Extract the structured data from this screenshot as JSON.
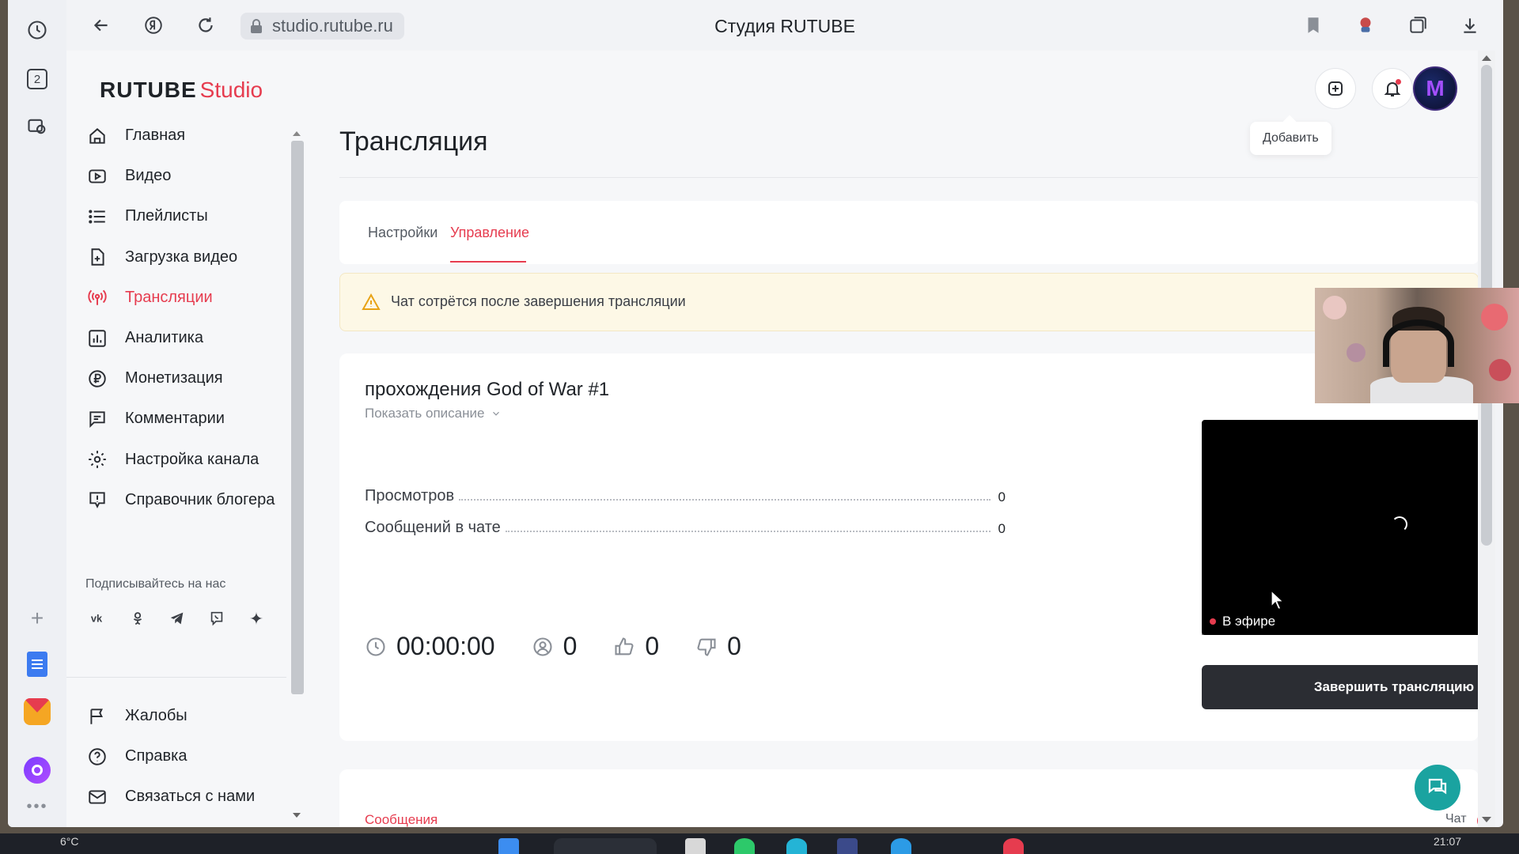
{
  "browser": {
    "url": "studio.rutube.ru",
    "tab_title": "Студия RUTUBE",
    "left_panel": {
      "tabs_count": "2"
    }
  },
  "app": {
    "logo_main": "RUTUBE",
    "logo_studio": "Studio",
    "tooltip_add": "Добавить"
  },
  "sidebar": {
    "items": [
      {
        "label": "Главная",
        "icon": "home-icon"
      },
      {
        "label": "Видео",
        "icon": "video-icon"
      },
      {
        "label": "Плейлисты",
        "icon": "list-icon"
      },
      {
        "label": "Загрузка видео",
        "icon": "upload-icon"
      },
      {
        "label": "Трансляции",
        "icon": "broadcast-icon",
        "active": true
      },
      {
        "label": "Аналитика",
        "icon": "chart-icon"
      },
      {
        "label": "Монетизация",
        "icon": "ruble-icon"
      },
      {
        "label": "Комментарии",
        "icon": "comment-icon"
      },
      {
        "label": "Настройка канала",
        "icon": "gear-icon"
      },
      {
        "label": "Справочник блогера",
        "icon": "info-icon"
      }
    ],
    "follow_title": "Подписывайтесь на нас",
    "socials": [
      "vk-icon",
      "ok-icon",
      "telegram-icon",
      "viber-icon",
      "dzen-icon"
    ],
    "bottom_items": [
      {
        "label": "Жалобы",
        "icon": "flag-icon"
      },
      {
        "label": "Справка",
        "icon": "help-icon"
      },
      {
        "label": "Связаться с нами",
        "icon": "mail-icon"
      }
    ]
  },
  "main": {
    "heading": "Трансляция",
    "tabs": [
      {
        "label": "Настройки"
      },
      {
        "label": "Управление",
        "active": true
      }
    ],
    "alert": "Чат сотрётся после завершения трансляции",
    "stream": {
      "title": "прохождения God of War #1",
      "show_description": "Показать описание",
      "stats": [
        {
          "label": "Просмотров",
          "value": "0"
        },
        {
          "label": "Сообщений в чате",
          "value": "0"
        }
      ],
      "timer": "00:00:00",
      "viewers": "0",
      "likes": "0",
      "dislikes": "0",
      "live_label": "В эфире",
      "end_button": "Завершить трансляцию"
    },
    "messages": {
      "title": "Сообщения",
      "chat_label": "Чат",
      "chat_enabled": true
    }
  },
  "taskbar": {
    "weather": "6°C",
    "time": "21:07"
  },
  "colors": {
    "accent": "#e63c4f",
    "dark_button": "#2b2d33",
    "alert_bg": "#fdf8e6",
    "fab": "#1aa3a0"
  }
}
